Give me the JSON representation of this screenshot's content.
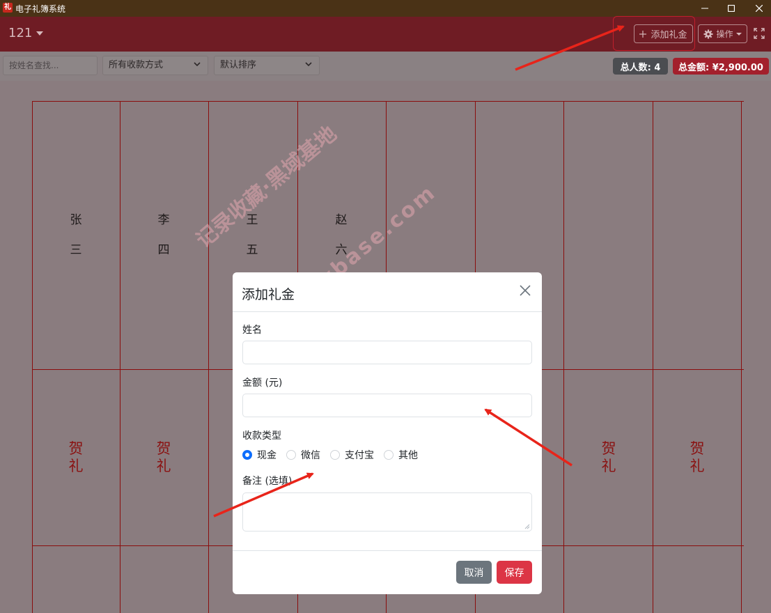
{
  "window": {
    "title": "电子礼簿系统",
    "app_icon_text": "礼"
  },
  "header": {
    "book_title": "121",
    "add_button": "添加礼金",
    "operations_button": "操作"
  },
  "toolbar": {
    "search_placeholder": "按姓名查找...",
    "payment_filter": "所有收款方式",
    "sort": "默认排序",
    "total_people": "总人数: 4",
    "total_amount": "总金额: ¥2,900.00"
  },
  "ledger": {
    "names": [
      [
        "张",
        "三"
      ],
      [
        "李",
        "四"
      ],
      [
        "王",
        "五"
      ],
      [
        "赵",
        "六"
      ]
    ],
    "gift_text": [
      "贺",
      "礼"
    ]
  },
  "watermark": {
    "line1": "记录收藏·黑域基地",
    "line2": "Hybase.com"
  },
  "modal": {
    "title": "添加礼金",
    "name_label": "姓名",
    "amount_label": "金额 (元)",
    "payment_type_label": "收款类型",
    "payment_options": [
      "现金",
      "微信",
      "支付宝",
      "其他"
    ],
    "selected_option": "现金",
    "note_label": "备注 (选填)",
    "cancel_button": "取消",
    "save_button": "保存"
  },
  "colors": {
    "title_bar": "#4a3216",
    "app_bar": "#6f1c24",
    "grid_line": "#8a0d0d",
    "gift_text": "#8a1212",
    "primary": "#0d6efd",
    "danger": "#dc3545",
    "secondary": "#6c757d",
    "annotation_arrow": "#e8241a"
  }
}
